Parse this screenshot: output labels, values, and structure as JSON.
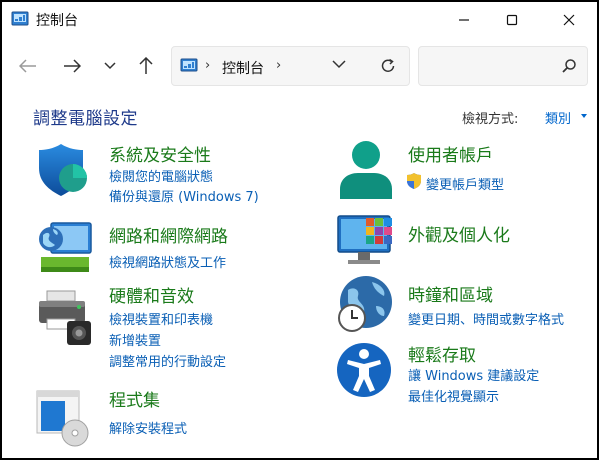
{
  "window": {
    "title": "控制台"
  },
  "navigation": {
    "address_path": "控制台",
    "search_placeholder": ""
  },
  "header": {
    "page_title": "調整電腦設定",
    "view_by_label": "檢視方式:",
    "view_by_value": "類別"
  },
  "categories": [
    {
      "title": "系統及安全性",
      "links": [
        "檢閱您的電腦狀態",
        "備份與還原 (Windows 7)"
      ]
    },
    {
      "title": "網路和網際網路",
      "links": [
        "檢視網路狀態及工作"
      ]
    },
    {
      "title": "硬體和音效",
      "links": [
        "檢視裝置和印表機",
        "新增裝置",
        "調整常用的行動設定"
      ]
    },
    {
      "title": "程式集",
      "links": [
        "解除安裝程式"
      ]
    },
    {
      "title": "使用者帳戶",
      "links": [
        "變更帳戶類型"
      ]
    },
    {
      "title": "外觀及個人化",
      "links": []
    },
    {
      "title": "時鐘和區域",
      "links": [
        "變更日期、時間或數字格式"
      ]
    },
    {
      "title": "輕鬆存取",
      "links": [
        "讓 Windows 建議設定",
        "最佳化視覺顯示"
      ]
    }
  ],
  "colors": {
    "title_blue": "#1e3a8a",
    "category_green": "#1a7a1a",
    "link_blue": "#0a5fb5",
    "accessibility_blue": "#1565c0",
    "user_teal": "#0f9a86"
  }
}
